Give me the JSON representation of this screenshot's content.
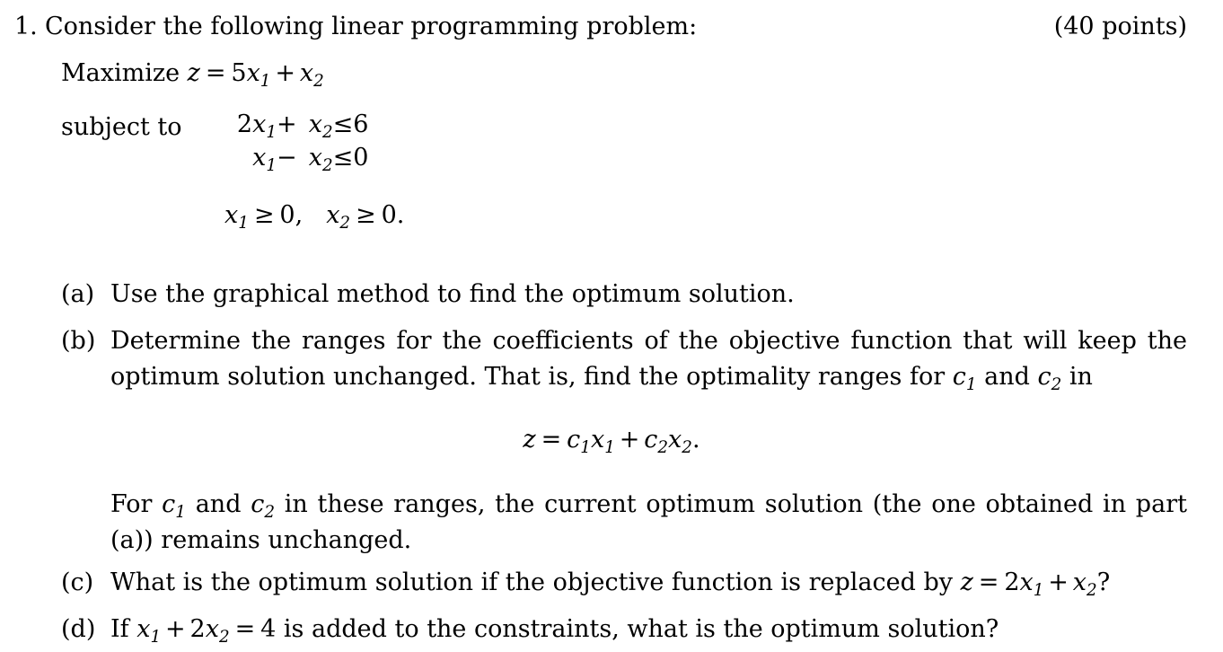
{
  "document": {
    "problem_number": "1.",
    "problem_intro": "Consider the following linear programming problem:",
    "points": "(40 points)",
    "objective": {
      "label": "Maximize",
      "variable": "z",
      "equals": "=",
      "term1_coefficient": "5",
      "term1_variable": "x",
      "term1_subscript": "1",
      "operator": "+",
      "term2_variable": "x",
      "term2_subscript": "2"
    },
    "subject_to_label": "subject to",
    "constraints": [
      {
        "lhs_coefficient": "2",
        "lhs_variable": "x",
        "lhs_subscript": "1",
        "operator": "+",
        "mid_variable": "x",
        "mid_subscript": "2",
        "relation": "≤",
        "rhs": "6"
      },
      {
        "lhs_coefficient": "",
        "lhs_variable": "x",
        "lhs_subscript": "1",
        "operator": "−",
        "mid_variable": "x",
        "mid_subscript": "2",
        "relation": "≤",
        "rhs": "0"
      }
    ],
    "nonnegativity": {
      "var1": "x",
      "sub1": "1",
      "rel1": "≥",
      "val1": "0,",
      "var2": "x",
      "sub2": "2",
      "rel2": "≥",
      "val2": "0."
    },
    "items": [
      {
        "tag": "(a)",
        "lines": [
          "Use the graphical method to find the optimum solution."
        ]
      },
      {
        "tag": "(b)",
        "line1": "Determine the ranges for the coefficients of the objective function that will keep the",
        "line2_part1": "optimum solution unchanged. That is, find the optimality ranges for",
        "line2_c1": "c",
        "line2_c1_sub": "1",
        "line2_and": "and",
        "line2_c2": "c",
        "line2_c2_sub": "2",
        "line2_part2": "in"
      },
      {
        "tag": "(c)",
        "text_before": "What is the optimum solution if the objective function is replaced by",
        "eq_z": "z",
        "eq_equals": "=",
        "eq_coefficient": "2",
        "eq_var1": "x",
        "eq_sub1": "1",
        "eq_op": "+",
        "eq_var2": "x",
        "eq_sub2": "2",
        "eq_tail": "?"
      },
      {
        "tag": "(d)",
        "text_before": "If",
        "eq_var1": "x",
        "eq_sub1": "1",
        "eq_op": "+",
        "eq_coefficient": "2",
        "eq_var2": "x",
        "eq_sub2": "2",
        "eq_equals": "=",
        "eq_rhs": "4",
        "text_after": "is added to the constraints, what is the optimum solution?"
      }
    ],
    "display_equation": {
      "z": "z",
      "equals": "=",
      "c1": "c",
      "c1_sub": "1",
      "x1": "x",
      "x1_sub": "1",
      "plus": "+",
      "c2": "c",
      "c2_sub": "2",
      "x2": "x",
      "x2_sub": "2",
      "period": "."
    },
    "for_paragraph": {
      "part1": "For",
      "c1": "c",
      "c1_sub": "1",
      "and": "and",
      "c2": "c",
      "c2_sub": "2",
      "part2": "in these ranges, the current optimum solution (the one obtained in part",
      "line2": "(a)) remains unchanged."
    }
  },
  "style": {
    "background_color": "#ffffff",
    "text_color": "#000000"
  }
}
